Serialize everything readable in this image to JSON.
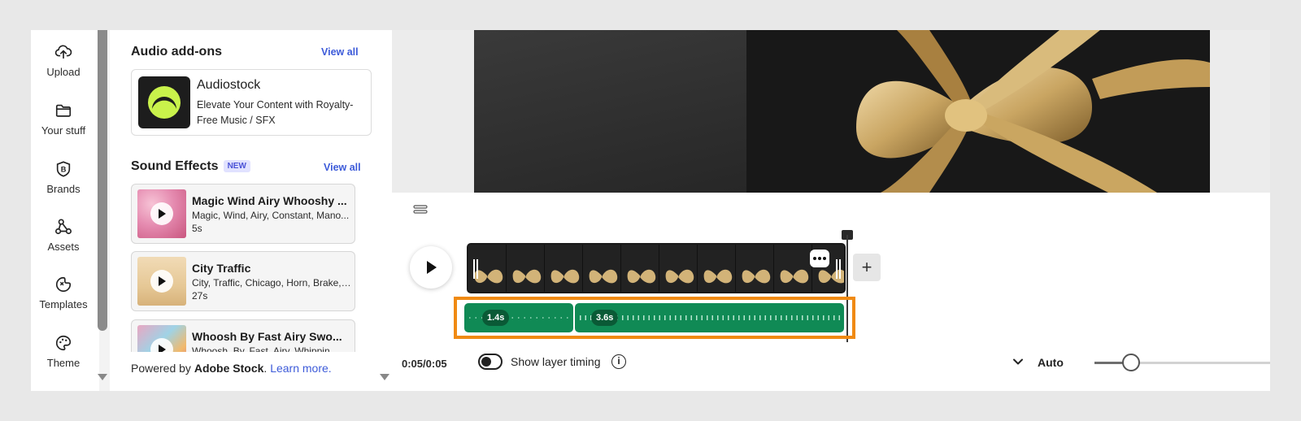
{
  "rail": {
    "items": [
      {
        "label": "Upload",
        "icon": "upload-icon"
      },
      {
        "label": "Your stuff",
        "icon": "folder-icon"
      },
      {
        "label": "Brands",
        "icon": "brand-icon"
      },
      {
        "label": "Assets",
        "icon": "assets-icon"
      },
      {
        "label": "Templates",
        "icon": "templates-icon"
      },
      {
        "label": "Theme",
        "icon": "theme-icon"
      }
    ]
  },
  "panel": {
    "audio_addons": {
      "title": "Audio add-ons",
      "view_all": "View all",
      "card": {
        "name": "Audiostock",
        "description": "Elevate Your Content with Royalty-Free Music / SFX"
      }
    },
    "sound_effects": {
      "title": "Sound Effects",
      "badge": "NEW",
      "view_all": "View all",
      "items": [
        {
          "title": "Magic Wind Airy Whooshy ...",
          "tags": "Magic, Wind, Airy, Constant, Mano...",
          "duration": "5s"
        },
        {
          "title": "City Traffic",
          "tags": "City, Traffic, Chicago, Horn, Brake, ...",
          "duration": "27s"
        },
        {
          "title": "Whoosh By Fast Airy Swo...",
          "tags": "Whoosh, By, Fast, Airy, Whippin...",
          "duration": ""
        }
      ]
    },
    "footer": {
      "prefix": "Powered by ",
      "brand": "Adobe Stock",
      "suffix": ". ",
      "link": "Learn more."
    }
  },
  "timeline": {
    "time": "0:05/0:05",
    "layer_timing_label": "Show layer timing",
    "layer_timing_on": false,
    "zoom_label": "Auto",
    "zoom_level": 0.21,
    "audio_segments": [
      {
        "label": "1.4s"
      },
      {
        "label": "3.6s"
      }
    ],
    "add_label": "+"
  },
  "colors": {
    "accent_link": "#3d5bd9",
    "audio_track": "#108a55",
    "highlight": "#f08a12"
  }
}
